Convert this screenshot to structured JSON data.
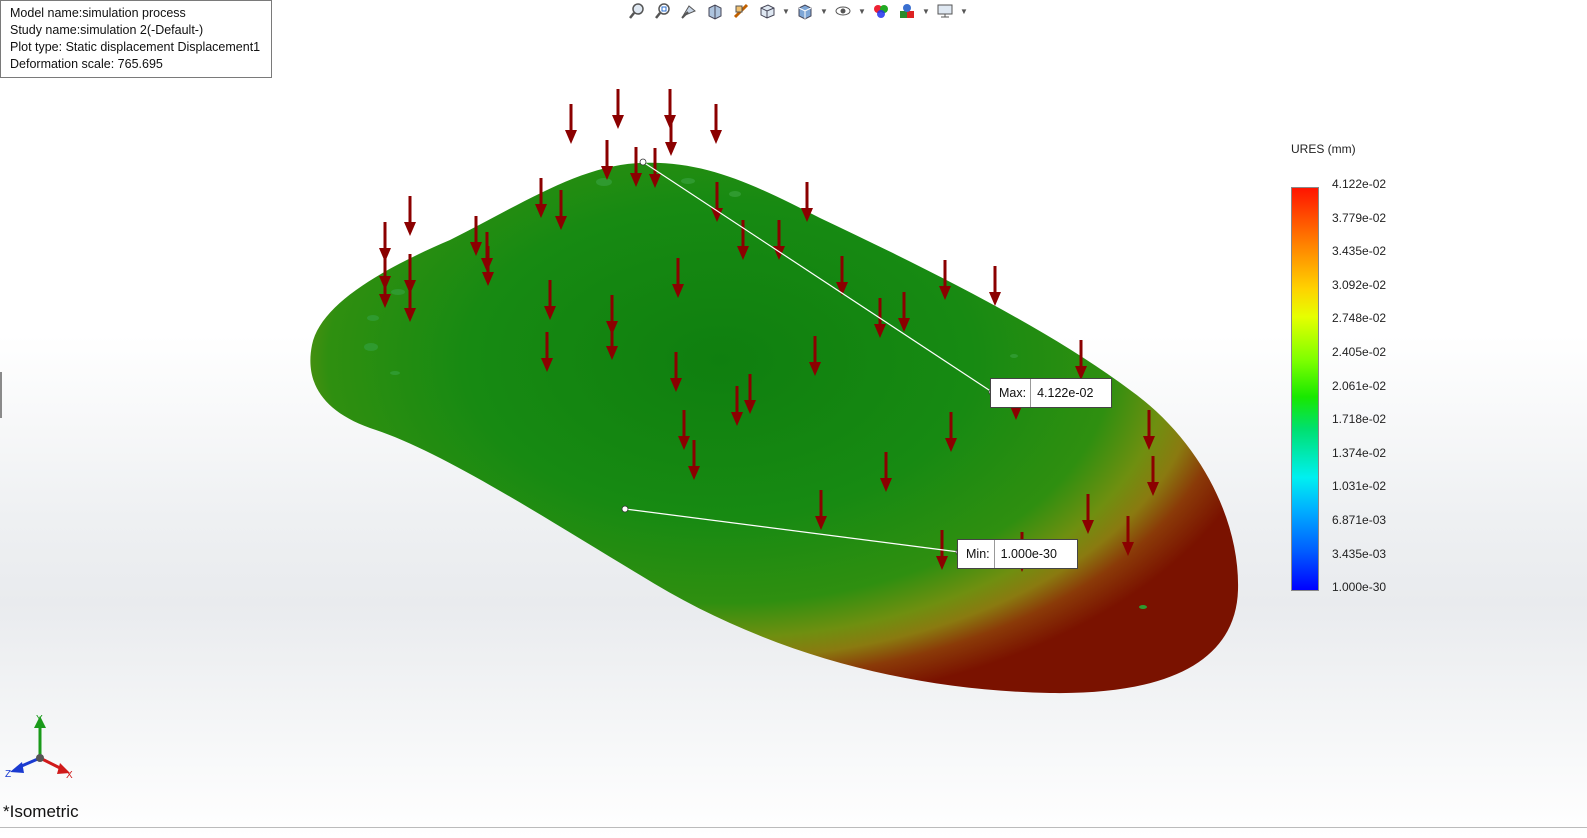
{
  "info": {
    "model_name": "Model name:simulation process",
    "study_name": "Study name:simulation 2(-Default-)",
    "plot_type": "Plot type: Static displacement Displacement1",
    "deformation_scale": "Deformation scale: 765.695"
  },
  "toolbar": {
    "icons": [
      "zoom-to-fit-icon",
      "zoom-to-area-icon",
      "previous-view-icon",
      "section-view-icon",
      "dynamic-annotation-icon",
      "view-orientation-icon",
      "display-style-icon",
      "hide-show-icon",
      "edit-appearance-icon",
      "apply-scene-icon",
      "view-settings-icon"
    ]
  },
  "legend": {
    "title": "URES (mm)",
    "values": [
      "4.122e-02",
      "3.779e-02",
      "3.435e-02",
      "3.092e-02",
      "2.748e-02",
      "2.405e-02",
      "2.061e-02",
      "1.718e-02",
      "1.374e-02",
      "1.031e-02",
      "6.871e-03",
      "3.435e-03",
      "1.000e-30"
    ]
  },
  "probe_max": {
    "label": "Max:",
    "value": "4.122e-02"
  },
  "probe_min": {
    "label": "Min:",
    "value": "1.000e-30"
  },
  "triad": {
    "x": "X",
    "y": "Y",
    "z": "Z"
  },
  "view_name": "*Isometric",
  "colors": {
    "load_arrow": "#8b0000",
    "surface_center": "#0f7f0f",
    "surface_edge": "#8a1a00"
  }
}
